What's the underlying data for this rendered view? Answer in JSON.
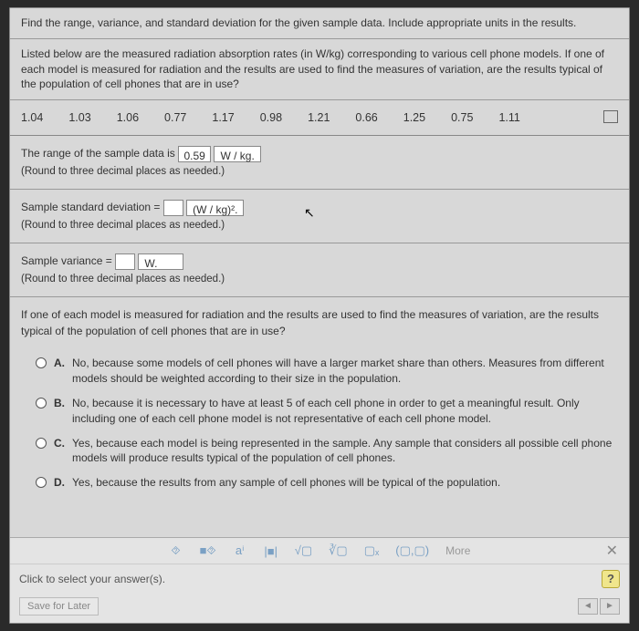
{
  "question": {
    "title": "Find the range, variance, and standard deviation for the given sample data. Include appropriate units in the results.",
    "context": "Listed below are the measured radiation absorption rates (in W/kg) corresponding to various cell phone models. If one of each model is measured for radiation and the results are used to find the measures of variation, are the results typical of the population of cell phones that are in use?",
    "data": [
      "1.04",
      "1.03",
      "1.06",
      "0.77",
      "1.17",
      "0.98",
      "1.21",
      "0.66",
      "1.25",
      "0.75",
      "1.11"
    ]
  },
  "parts": {
    "range": {
      "prefix": "The range of the sample data is",
      "value": "0.59",
      "unit": "W / kg.",
      "hint": "(Round to three decimal places as needed.)"
    },
    "stddev": {
      "prefix": "Sample standard deviation =",
      "value": "",
      "unit": "(W / kg)².",
      "hint": "(Round to three decimal places as needed.)"
    },
    "variance": {
      "prefix": "Sample variance =",
      "value": "",
      "unit": "W.",
      "hint": "(Round to three decimal places as needed.)"
    }
  },
  "mc": {
    "prompt": "If one of each model is measured for radiation and the results are used to find the measures of variation, are the results typical of the population of cell phones that are in use?",
    "options": [
      {
        "label": "A.",
        "text": "No, because some models of cell phones will have a larger market share than others. Measures from different models should be weighted according to their size in the population."
      },
      {
        "label": "B.",
        "text": "No, because it is necessary to have at least 5 of each cell phone in order to get a meaningful result. Only including one of each cell phone model is not representative of each cell phone model."
      },
      {
        "label": "C.",
        "text": "Yes, because each model is being represented in the sample. Any sample that considers all possible cell phone models will produce results typical of the population of cell phones."
      },
      {
        "label": "D.",
        "text": "Yes, because the results from any sample of cell phones will be typical of the population."
      }
    ]
  },
  "toolbar": {
    "tools": [
      "⯑",
      "■⯑",
      "aⁱ",
      "|■|",
      "√▢",
      "∛▢",
      "▢ₓ",
      "(▢,▢)"
    ],
    "more": "More",
    "close": "✕"
  },
  "footer": {
    "click_hint": "Click to select your answer(s).",
    "help": "?",
    "save": "Save for Later",
    "nav_prev": "◄",
    "nav_next": "►"
  }
}
